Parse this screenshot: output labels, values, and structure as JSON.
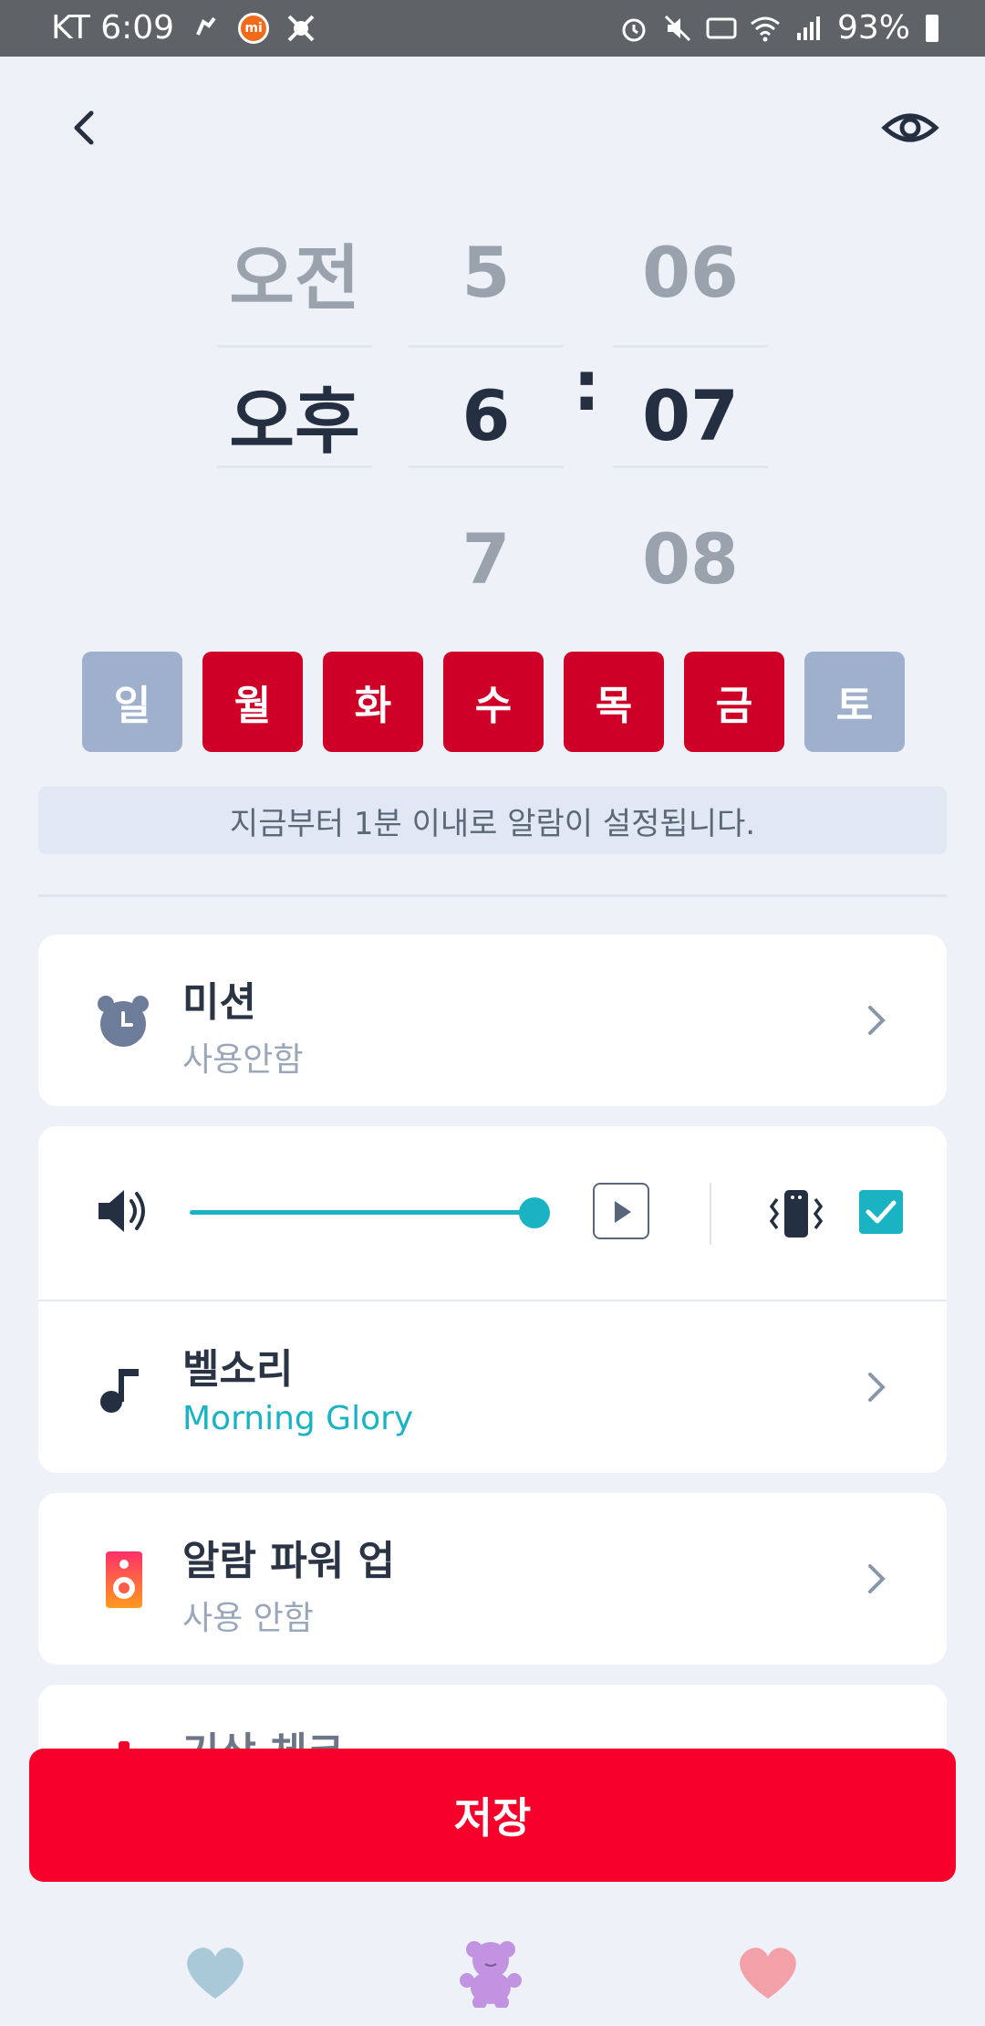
{
  "status_bar": {
    "carrier_time": "KT 6:09",
    "battery": "93%"
  },
  "picker": {
    "ampm": [
      "오전",
      "오후",
      ""
    ],
    "hours": [
      "5",
      "6",
      "7"
    ],
    "minutes": [
      "06",
      "07",
      "08"
    ],
    "colon": ":"
  },
  "days": [
    {
      "label": "일",
      "on": false
    },
    {
      "label": "월",
      "on": true
    },
    {
      "label": "화",
      "on": true
    },
    {
      "label": "수",
      "on": true
    },
    {
      "label": "목",
      "on": true
    },
    {
      "label": "금",
      "on": true
    },
    {
      "label": "토",
      "on": false
    }
  ],
  "info_text": "지금부터 1분 이내로 알람이 설정됩니다.",
  "mission": {
    "title": "미션",
    "sub": "사용안함"
  },
  "volume": {
    "level": 1.0,
    "vibrate_checked": true
  },
  "ringtone": {
    "title": "벨소리",
    "sub": "Morning Glory"
  },
  "power_up": {
    "title": "알람 파워 업",
    "sub": "사용 안함"
  },
  "wake_check": {
    "title": "기상 체크"
  },
  "save_label": "저장",
  "colors": {
    "accent": "#19b3c4",
    "day_on": "#cf0027",
    "save": "#f6002b"
  }
}
